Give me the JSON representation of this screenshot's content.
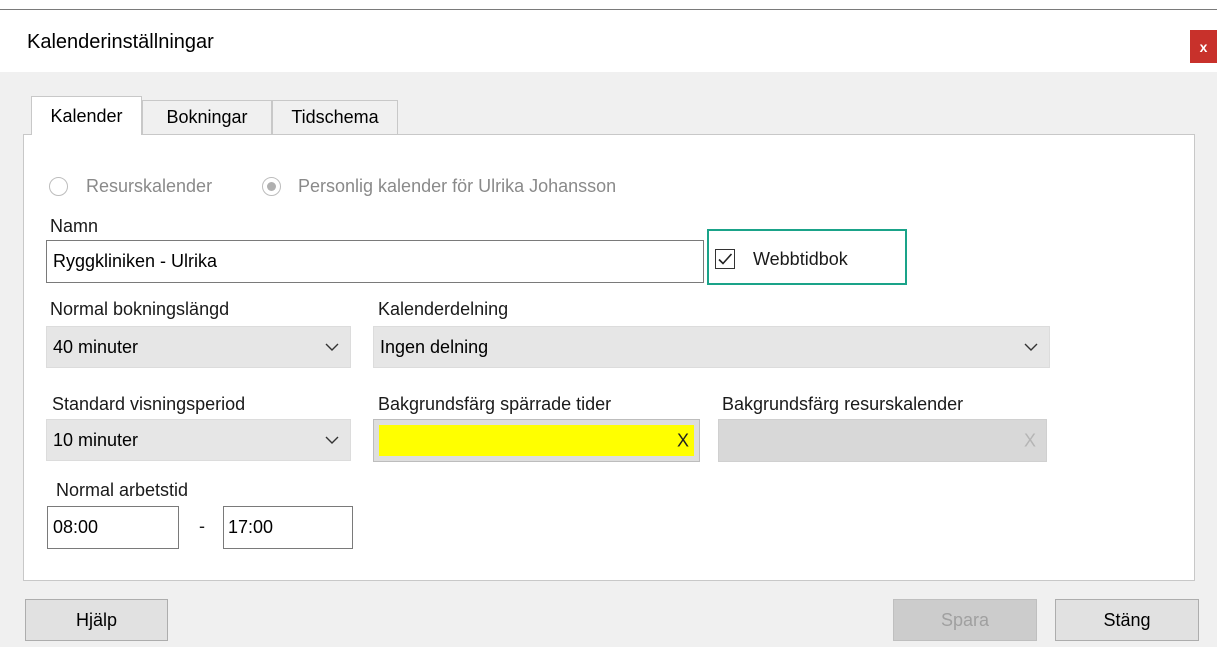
{
  "window": {
    "title": "Kalenderinställningar",
    "close_label": "x"
  },
  "tabs": [
    {
      "label": "Kalender",
      "active": true
    },
    {
      "label": "Bokningar",
      "active": false
    },
    {
      "label": "Tidschema",
      "active": false
    }
  ],
  "calendar_type": {
    "options": [
      {
        "label": "Resurskalender",
        "selected": false
      },
      {
        "label": "Personlig kalender för Ulrika Johansson",
        "selected": true
      }
    ],
    "disabled": true
  },
  "name": {
    "label": "Namn",
    "value": "Ryggkliniken - Ulrika"
  },
  "webbtidbok": {
    "label": "Webbtidbok",
    "checked": true
  },
  "booking_length": {
    "label": "Normal bokningslängd",
    "value": "40 minuter"
  },
  "sharing": {
    "label": "Kalenderdelning",
    "value": "Ingen delning"
  },
  "view_period": {
    "label": "Standard visningsperiod",
    "value": "10 minuter"
  },
  "blocked_bg": {
    "label": "Bakgrundsfärg spärrade tider",
    "clear_label": "X",
    "color": "#ffff00"
  },
  "resource_bg": {
    "label": "Bakgrundsfärg resurskalender",
    "clear_label": "X",
    "color": "#d8d8d8"
  },
  "work_hours": {
    "label": "Normal arbetstid",
    "start": "08:00",
    "separator": "-",
    "end": "17:00"
  },
  "buttons": {
    "help": "Hjälp",
    "save": "Spara",
    "close": "Stäng"
  },
  "colors": {
    "highlight": "#1aa389",
    "close_button": "#c8312b"
  },
  "icons": {
    "dropdown": "chevron-down-icon",
    "checkmark": "checkmark-icon"
  }
}
